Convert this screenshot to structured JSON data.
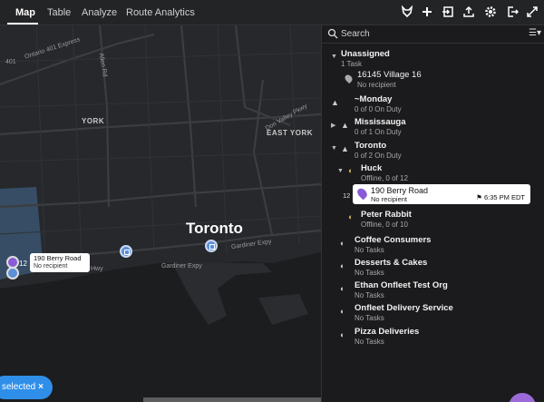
{
  "tabs": [
    {
      "label": "Map",
      "active": true
    },
    {
      "label": "Table",
      "active": false
    },
    {
      "label": "Analyze",
      "active": false
    },
    {
      "label": "Route Analytics",
      "active": false
    }
  ],
  "toolbar_icons": [
    "fox-icon",
    "plus-icon",
    "import-icon",
    "export-icon",
    "gear-icon",
    "logout-icon",
    "expand-icon"
  ],
  "map": {
    "city": "Toronto",
    "labels": {
      "york": "YORK",
      "east_york": "EAST YORK"
    },
    "roads": {
      "r401": "401",
      "ontario_401": "Ontario 401 Express",
      "allen": "Allen Rd",
      "dvp": "Don Valley Pkwy",
      "gardiner1": "Gardiner Expy",
      "gardiner2": "Gardiner Expy",
      "hwy": "Hwy"
    },
    "popup": {
      "title": "190 Berry Road",
      "subtitle": "No recipient",
      "count": "12"
    },
    "selected_label": "selected",
    "selected_close": "×"
  },
  "search": {
    "placeholder": "Search"
  },
  "groups": [
    {
      "title": "Unassigned",
      "sub": "1 Task"
    },
    {
      "title": "16145 Village 16",
      "sub": "No recipient"
    },
    {
      "title": "~Monday",
      "sub": "0 of 0 On Duty"
    },
    {
      "title": "Mississauga",
      "sub": "0 of 1 On Duty"
    },
    {
      "title": "Toronto",
      "sub": "0 of 2 On Duty"
    },
    {
      "title": "Huck",
      "sub": "Offline, 0 of 12"
    },
    {
      "title": "Peter Rabbit",
      "sub": "Offline, 0 of 10"
    },
    {
      "title": "Coffee Consumers",
      "sub": "No Tasks"
    },
    {
      "title": "Desserts & Cakes",
      "sub": "No Tasks"
    },
    {
      "title": "Ethan Onfleet Test Org",
      "sub": "No Tasks"
    },
    {
      "title": "Onfleet Delivery Service",
      "sub": "No Tasks"
    },
    {
      "title": "Pizza Deliveries",
      "sub": "No Tasks"
    }
  ],
  "task": {
    "num": "12",
    "title": "190 Berry Road",
    "subtitle": "No recipient",
    "eta": "6:35 PM EDT"
  },
  "colors": {
    "accent": "#2f8fe8",
    "task_pin": "#8a5bd6",
    "water": "#1c1d1f",
    "land": "#26282b"
  }
}
